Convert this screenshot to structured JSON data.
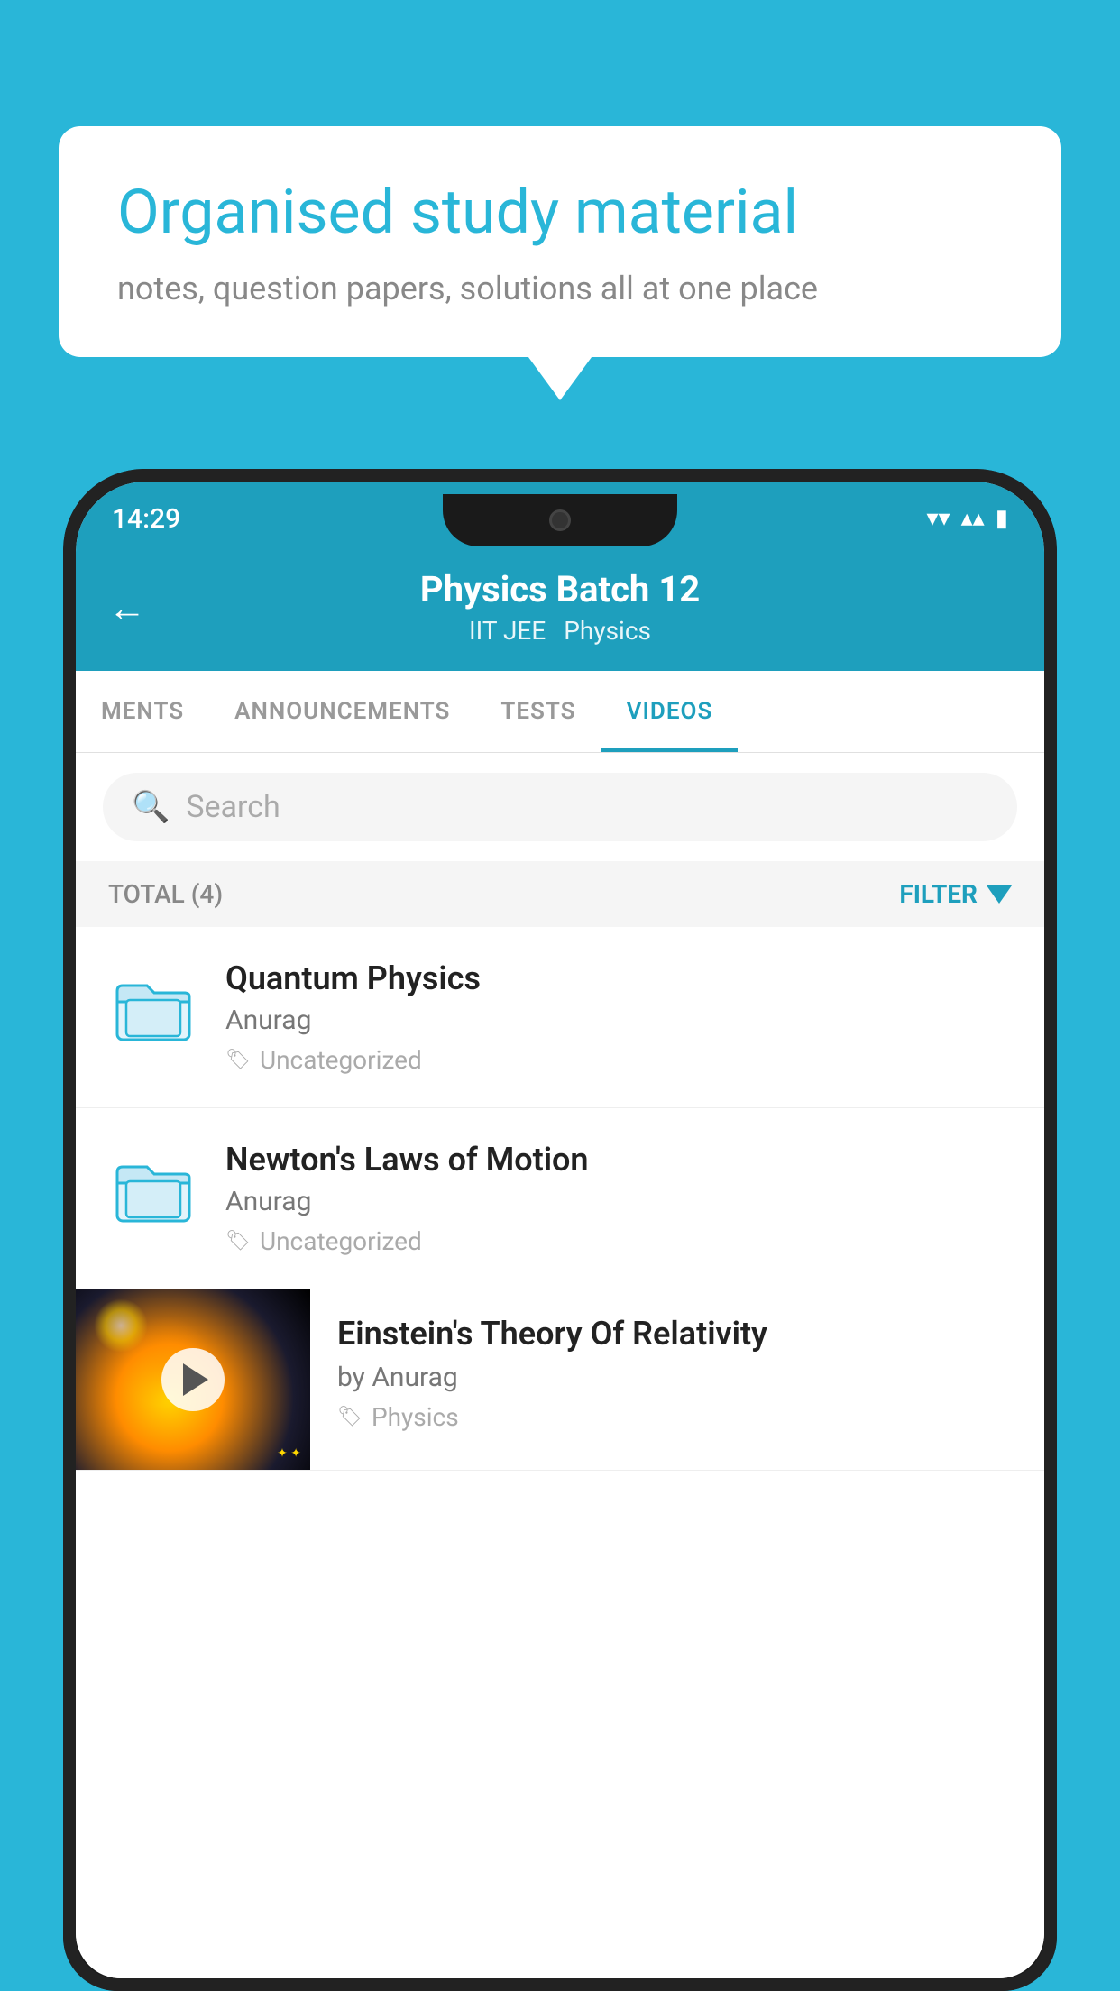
{
  "background_color": "#29b6d8",
  "speech_bubble": {
    "title": "Organised study material",
    "subtitle": "notes, question papers, solutions all at one place"
  },
  "status_bar": {
    "time": "14:29",
    "wifi": "▾",
    "signal": "▴",
    "battery": "▮"
  },
  "app_header": {
    "title": "Physics Batch 12",
    "subtitle1": "IIT JEE",
    "subtitle2": "Physics",
    "back_label": "←"
  },
  "tabs": [
    {
      "label": "MENTS",
      "active": false
    },
    {
      "label": "ANNOUNCEMENTS",
      "active": false
    },
    {
      "label": "TESTS",
      "active": false
    },
    {
      "label": "VIDEOS",
      "active": true
    }
  ],
  "search": {
    "placeholder": "Search"
  },
  "filter_bar": {
    "total_label": "TOTAL (4)",
    "filter_label": "FILTER"
  },
  "videos": [
    {
      "title": "Quantum Physics",
      "author": "Anurag",
      "tag": "Uncategorized",
      "has_thumbnail": false
    },
    {
      "title": "Newton's Laws of Motion",
      "author": "Anurag",
      "tag": "Uncategorized",
      "has_thumbnail": false
    },
    {
      "title": "Einstein's Theory Of Relativity",
      "author": "by Anurag",
      "tag": "Physics",
      "has_thumbnail": true
    }
  ]
}
